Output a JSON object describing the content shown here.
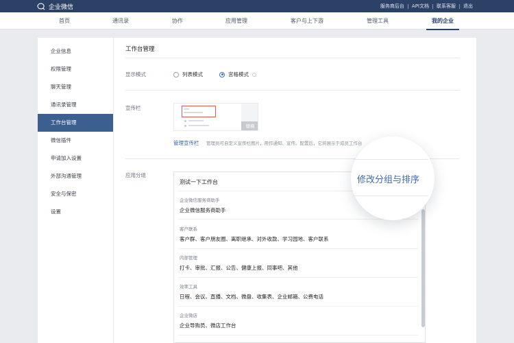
{
  "topbar": {
    "brand": "企业微信",
    "links": [
      "服务商后台",
      "API文档",
      "联系客服",
      "退出"
    ]
  },
  "nav": {
    "items": [
      "首页",
      "通讯录",
      "协作",
      "应用管理",
      "客户与上下游",
      "管理工具",
      "我的企业"
    ],
    "active": "我的企业"
  },
  "sidebar": {
    "items": [
      "企业信息",
      "权限管理",
      "聊天管理",
      "通讯录管理",
      "工作台管理",
      "微信插件",
      "申请加入设置",
      "外部沟通管理",
      "安全与保密",
      "设置"
    ],
    "active": "工作台管理"
  },
  "main": {
    "title": "工作台管理",
    "display_mode": {
      "label": "显示模式",
      "options": [
        "列表模式",
        "宫格模式"
      ],
      "selected": "宫格模式"
    },
    "banner": {
      "label": "宣传栏",
      "replace_label": "替换",
      "manage_link": "管理宣传栏",
      "hint": "管理员可自定义宣传栏图片，用作通知、宣传。配置后，它将展示于成员工作台"
    },
    "app_groups": {
      "label": "应用分组",
      "group_title": "测试一下工作台",
      "edit_label": "修改分组与排序",
      "categories": [
        {
          "name": "企业微信服务商助手",
          "apps": "企业微信服务商助手"
        },
        {
          "name": "客户联系",
          "apps": "客户群、客户朋友圈、离职继承、对外收款、学习园地、客户联系"
        },
        {
          "name": "内部管理",
          "apps": "打卡、审批、汇报、公告、健康上报、同事吧、其他"
        },
        {
          "name": "效率工具",
          "apps": "日程、会议、直播、文档、微盘、收集表、企业邮箱、公费电话"
        },
        {
          "name": "企业微店",
          "apps": "企业导购员、微店工作台"
        }
      ]
    }
  },
  "colors": {
    "topbar": "#2b4166",
    "sidebar_active": "#3b5f8e",
    "link": "#2f63b5",
    "accent": "#3e6aa8"
  }
}
